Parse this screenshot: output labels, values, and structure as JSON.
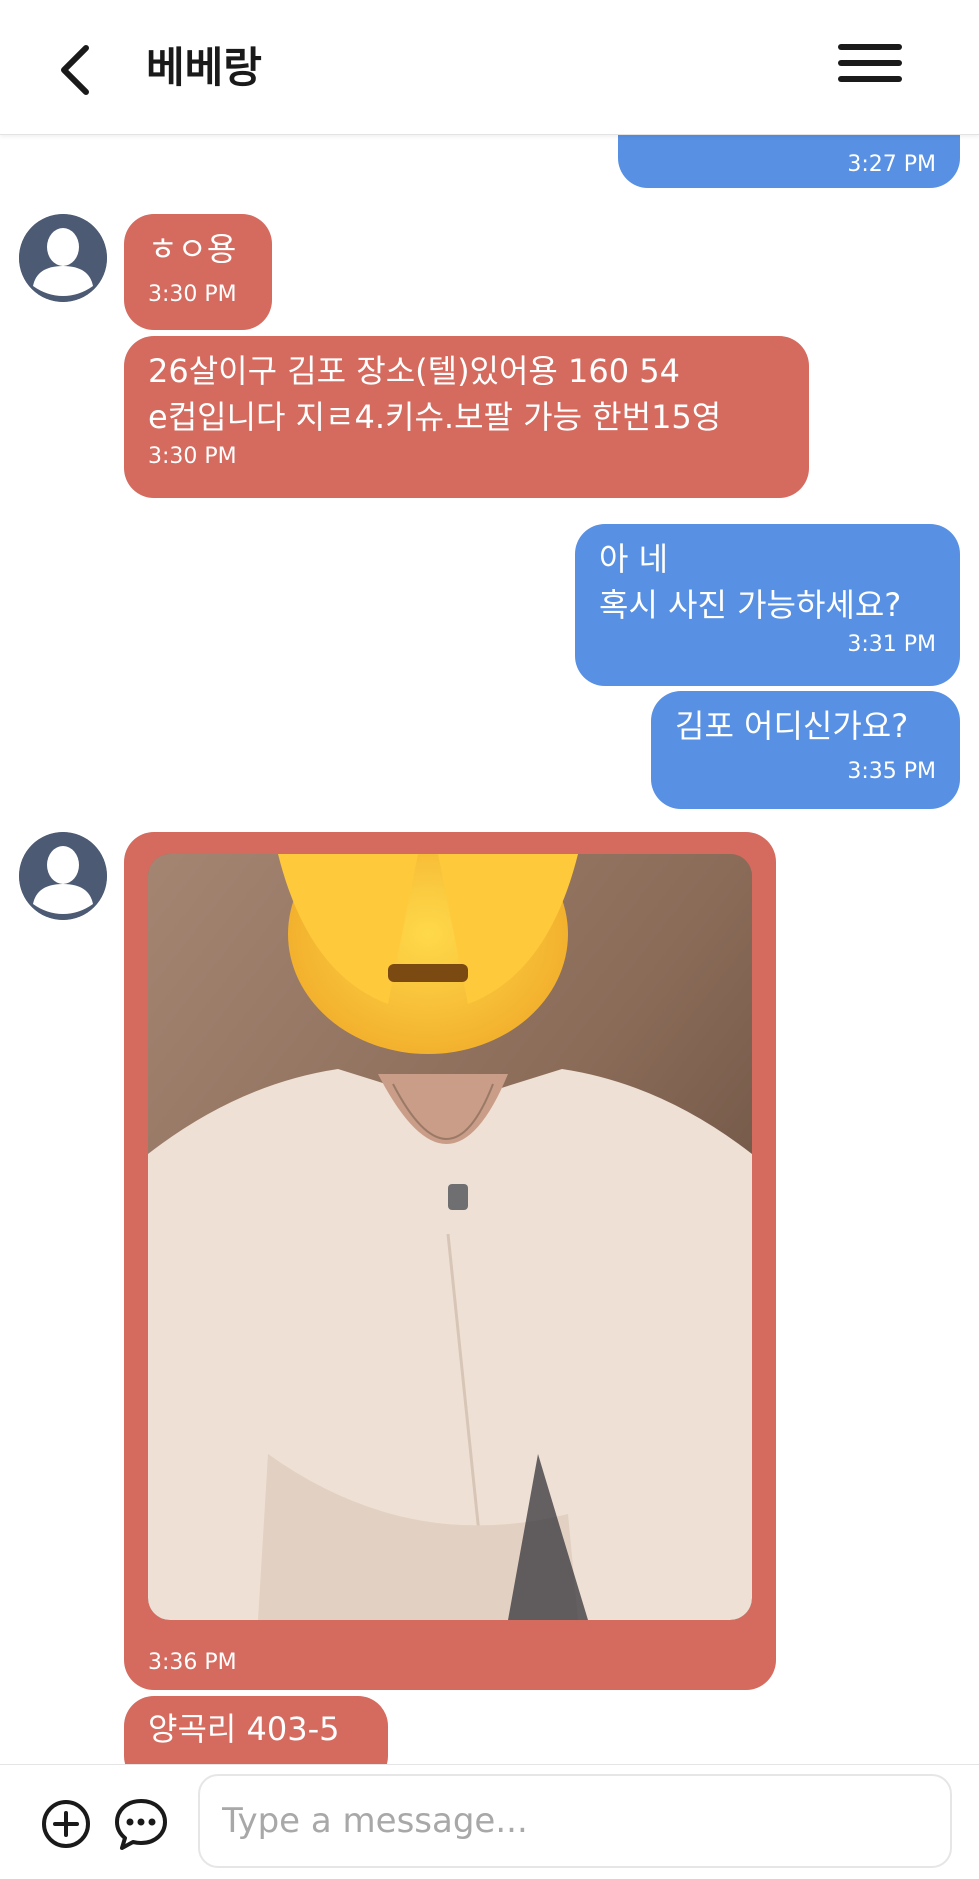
{
  "header": {
    "title": "베베랑",
    "back_icon": "chevron-left-icon",
    "menu_icon": "hamburger-menu-icon"
  },
  "messages": [
    {
      "direction": "out",
      "text": "",
      "time": "3:27 PM"
    },
    {
      "direction": "in",
      "text": "ㅎㅇ용",
      "time": "3:30 PM"
    },
    {
      "direction": "in",
      "text": "26살이구 김포 장소(텔)있어용 160 54\ne컵입니다 지ㄹ4.키슈.보팔 가능 한번15영",
      "time": "3:30 PM"
    },
    {
      "direction": "out",
      "text": "아 네\n혹시 사진 가능하세요?",
      "time": "3:31 PM"
    },
    {
      "direction": "out",
      "text": "김포 어디신가요?",
      "time": "3:35 PM"
    },
    {
      "direction": "in",
      "type": "image",
      "time": "3:36 PM"
    },
    {
      "direction": "in",
      "text": "양곡리 403-5",
      "time": ""
    }
  ],
  "composer": {
    "placeholder": "Type a message...",
    "add_icon": "plus-circle-icon",
    "chat_icon": "chat-bubble-dots-icon"
  },
  "colors": {
    "incoming_bubble": "#d56a5e",
    "outgoing_bubble": "#5890e3",
    "avatar": "#4c5a73"
  }
}
